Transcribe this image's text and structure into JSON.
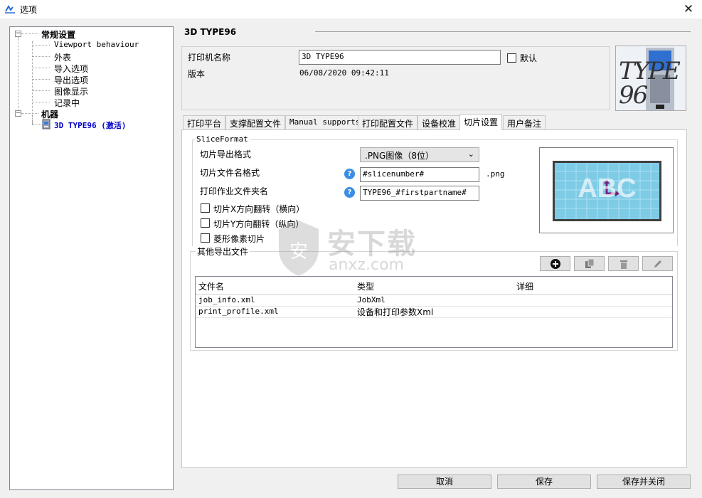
{
  "window": {
    "title": "选项"
  },
  "tree": {
    "general": {
      "label": "常规设置",
      "children": [
        "Viewport behaviour",
        "外表",
        "导入选项",
        "导出选项",
        "图像显示",
        "记录中"
      ]
    },
    "machines": {
      "label": "机器",
      "children": [
        "3D TYPE96 (激活)"
      ]
    }
  },
  "printer": {
    "title": "3D TYPE96",
    "name_label": "打印机名称",
    "name_value": "3D TYPE96",
    "default_label": "默认",
    "version_label": "版本",
    "version_value": "06/08/2020 09:42:11",
    "image_text": "TYPE 96"
  },
  "tabs": [
    "打印平台",
    "支撑配置文件",
    "Manual supports",
    "打印配置文件",
    "设备校准",
    "切片设置",
    "用户备注"
  ],
  "active_tab_index": 5,
  "slice": {
    "group_title": "SliceFormat",
    "export_format_label": "切片导出格式",
    "export_format_value": ".PNG图像（8位）",
    "filename_label": "切片文件名格式",
    "filename_value": "#slicenumber#",
    "filename_ext": ".png",
    "job_folder_label": "打印作业文件夹名",
    "job_folder_value": "TYPE96_#firstpartname#",
    "flip_x_label": "切片X方向翻转（横向）",
    "flip_y_label": "切片Y方向翻转（纵向）",
    "diamond_label": "菱形像素切片",
    "preview_text": "ABC"
  },
  "other_files": {
    "title": "其他导出文件",
    "columns": [
      "文件名",
      "类型",
      "详细"
    ],
    "rows": [
      [
        "job_info.xml",
        "JobXml",
        ""
      ],
      [
        "print_profile.xml",
        "设备和打印参数Xml",
        ""
      ]
    ]
  },
  "buttons": {
    "cancel": "取消",
    "save": "保存",
    "save_close": "保存并关闭"
  },
  "watermark": {
    "brand": "安下载",
    "domain": "anxz.com"
  },
  "colors": {
    "active_node": "#0000cc",
    "help_icon": "#3a8ee6",
    "preview_grid": "#7ecbe6",
    "preview_arrow": "#7a1a7a"
  }
}
